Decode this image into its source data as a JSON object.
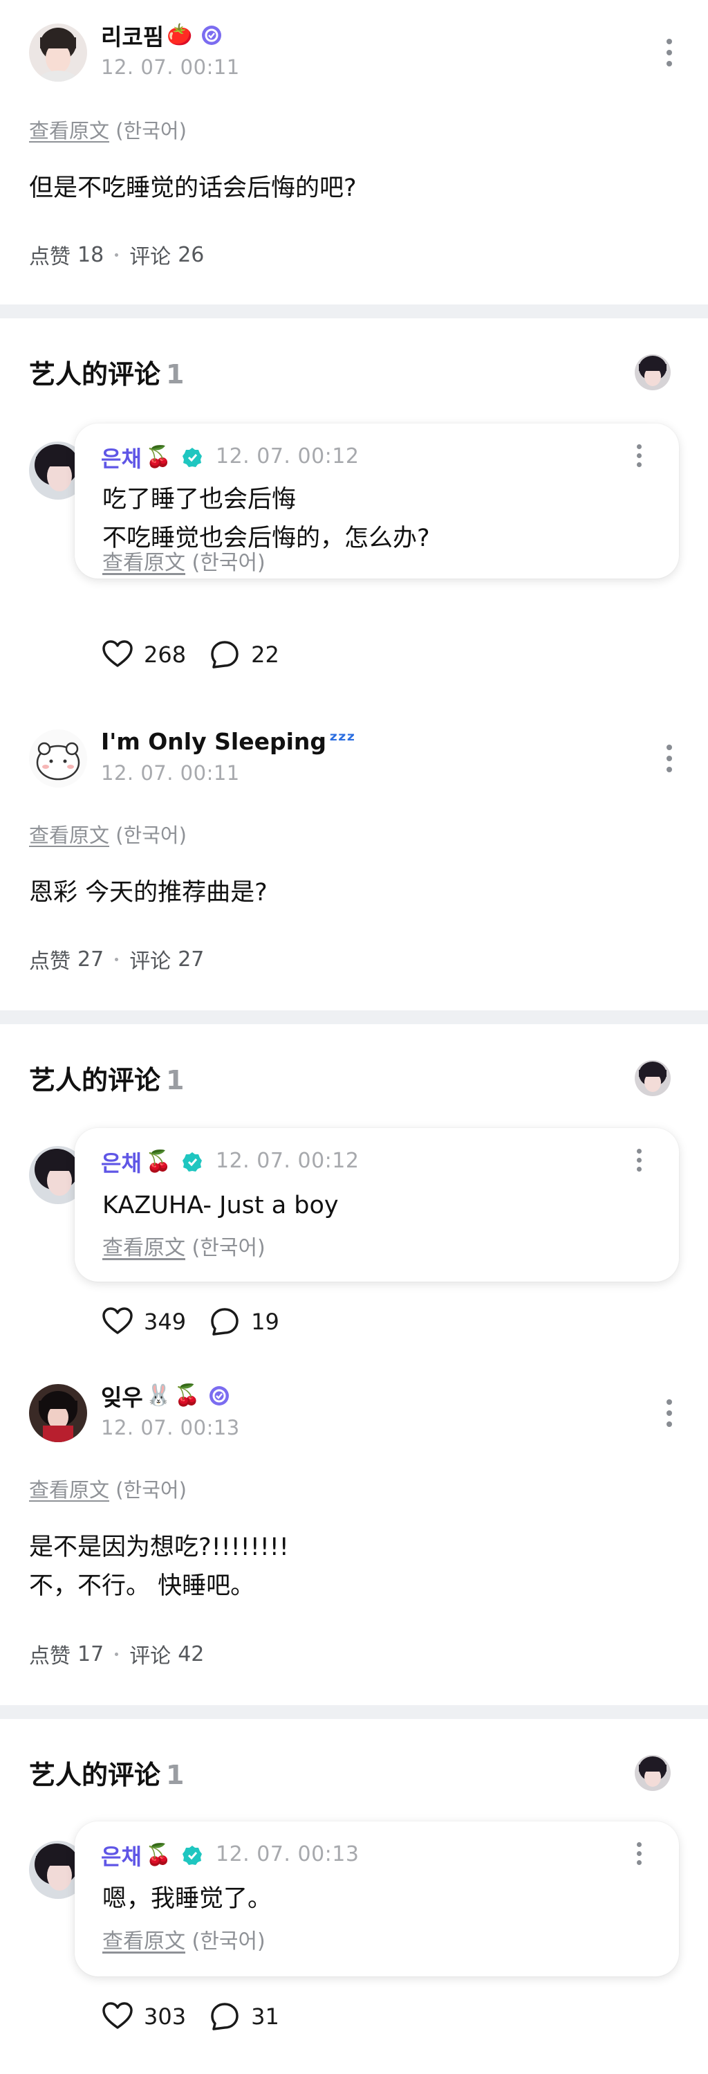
{
  "posts": [
    {
      "name": "리코핌",
      "emojis": [
        "🍅"
      ],
      "verified": true,
      "timestamp": "12. 07. 00:11",
      "translate_link": "查看原文",
      "translate_lang": "(한국어)",
      "text": "但是不吃睡觉的话会后悔的吧?",
      "likes_label": "点赞",
      "likes": "18",
      "comments_label": "评论",
      "comments": "26"
    },
    {
      "name": "I'm Only Sleeping",
      "emojis": [
        "ᶻᶻᶻ"
      ],
      "verified": false,
      "timestamp": "12. 07. 00:11",
      "translate_link": "查看原文",
      "translate_lang": "(한국어)",
      "text": "恩彩 今天的推荐曲是?",
      "likes_label": "点赞",
      "likes": "27",
      "comments_label": "评论",
      "comments": "27"
    },
    {
      "name": "잊우",
      "emojis": [
        "🐰",
        "🍒"
      ],
      "verified": true,
      "timestamp": "12. 07. 00:13",
      "translate_link": "查看原文",
      "translate_lang": "(한국어)",
      "text": "是不是因为想吃?!!!!!!!!\n不，不行。 快睡吧。",
      "likes_label": "点赞",
      "likes": "17",
      "comments_label": "评论",
      "comments": "42"
    }
  ],
  "artist_sections": [
    {
      "title": "艺人的评论",
      "count": "1",
      "artist_name": "은채",
      "artist_emoji": "🍒",
      "timestamp": "12. 07. 00:12",
      "text": "吃了睡了也会后悔\n不吃睡觉也会后悔的，怎么办?",
      "translate_link": "查看原文",
      "translate_lang": "(한국어)",
      "likes": "268",
      "comments": "22"
    },
    {
      "title": "艺人的评论",
      "count": "1",
      "artist_name": "은채",
      "artist_emoji": "🍒",
      "timestamp": "12. 07. 00:12",
      "text": "KAZUHA- Just a boy",
      "translate_link": "查看原文",
      "translate_lang": "(한국어)",
      "likes": "349",
      "comments": "19"
    },
    {
      "title": "艺人的评论",
      "count": "1",
      "artist_name": "은채",
      "artist_emoji": "🍒",
      "timestamp": "12. 07. 00:13",
      "text": "嗯，我睡觉了。",
      "translate_link": "查看原文",
      "translate_lang": "(한국어)",
      "likes": "303",
      "comments": "31"
    }
  ],
  "colors": {
    "artist_name": "#5f56e6",
    "verified_fan": "#7b6cf0",
    "verified_artist": "#1fc6c0",
    "divider": "#eef0f3"
  },
  "icons": [
    "more-vertical-icon",
    "verified-icon",
    "heart-icon",
    "comment-bubble-icon"
  ]
}
